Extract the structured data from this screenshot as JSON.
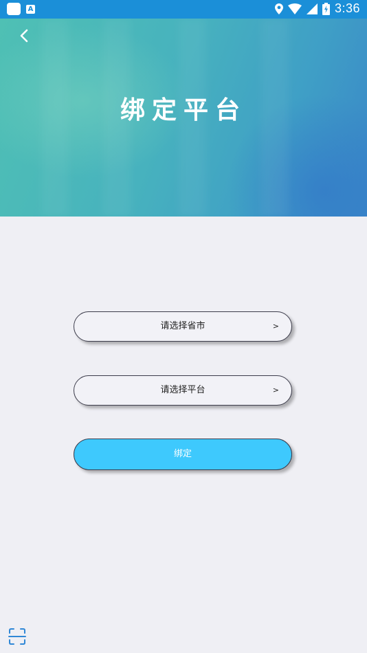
{
  "status_bar": {
    "time": "3:36",
    "left_icons": [
      "app-square-icon",
      "a-notification-icon"
    ],
    "a_icon_letter": "A",
    "right_icons": [
      "location-icon",
      "wifi-icon",
      "signal-icon",
      "battery-charging-icon"
    ]
  },
  "header": {
    "back_icon": "chevron-left-icon",
    "title": "绑定平台"
  },
  "form": {
    "province_select": {
      "label": "请选择省市",
      "arrow": ">"
    },
    "platform_select": {
      "label": "请选择平台",
      "arrow": ">"
    },
    "bind_button": {
      "label": "绑定"
    }
  },
  "footer": {
    "scan_icon": "scan-icon"
  },
  "colors": {
    "status_bar": "#1b8fd8",
    "hero_start": "#4fc0b4",
    "hero_end": "#3a86c8",
    "page_background": "#efeff4",
    "bind_button": "#3ec9fd",
    "scan_icon": "#2f87d6"
  }
}
